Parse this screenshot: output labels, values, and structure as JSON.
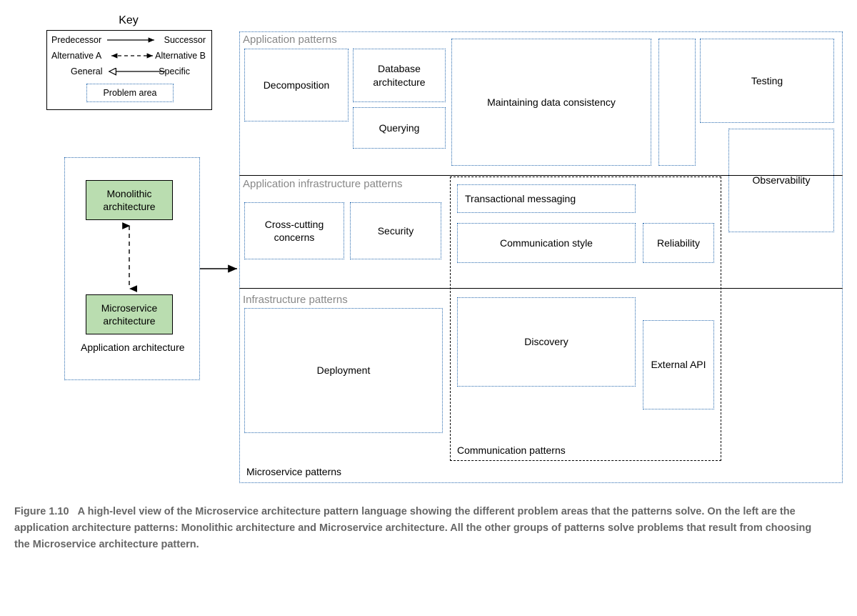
{
  "key": {
    "title": "Key",
    "predecessor": "Predecessor",
    "successor": "Successor",
    "altA": "Alternative A",
    "altB": "Alternative B",
    "general": "General",
    "specific": "Specific",
    "problemArea": "Problem area"
  },
  "left": {
    "mono": "Monolithic architecture",
    "micro": "Microservice architecture",
    "appArch": "Application architecture"
  },
  "sections": {
    "appPatterns": "Application patterns",
    "appInfraPatterns": "Application infrastructure patterns",
    "infraPatterns": "Infrastructure patterns",
    "microPatterns": "Microservice patterns",
    "commPatterns": "Communication patterns"
  },
  "boxes": {
    "decomp": "Decomposition",
    "dbArch": "Database architecture",
    "querying": "Querying",
    "maintain": "Maintaining data consistency",
    "testing": "Testing",
    "cross": "Cross-cutting concerns",
    "security": "Security",
    "txMsg": "Transactional messaging",
    "commStyle": "Communication style",
    "reliability": "Reliability",
    "observ": "Observability",
    "deploy": "Deployment",
    "discovery": "Discovery",
    "extApi": "External API"
  },
  "caption": {
    "label": "Figure 1.10",
    "text": "A high-level view of the Microservice architecture pattern language showing the different problem areas that the patterns solve. On the left are the application architecture patterns: Monolithic architecture and Microservice architecture. All the other groups of patterns solve problems that result from choosing the Microservice architecture pattern."
  }
}
